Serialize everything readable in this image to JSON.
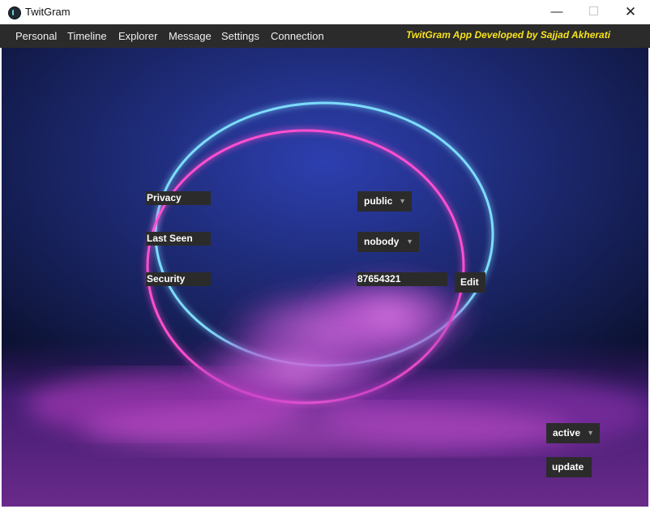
{
  "window": {
    "title": "TwitGram",
    "controls": {
      "minimize": "—",
      "maximize": "",
      "close": "✕"
    }
  },
  "menu": {
    "items": [
      {
        "label": "Personal"
      },
      {
        "label": "Timeline"
      },
      {
        "label": "Explorer"
      },
      {
        "label": "Message"
      },
      {
        "label": "Settings"
      },
      {
        "label": "Connection"
      }
    ],
    "credit": "TwitGram App Developed by Sajjad Akherati",
    "credit_color": "#f7e21c"
  },
  "settings": {
    "privacy_label": "Privacy",
    "privacy_value": "public",
    "last_seen_label": "Last Seen",
    "last_seen_value": "nobody",
    "security_label": "Security",
    "security_value": "87654321",
    "edit_button": "Edit",
    "status_value": "active",
    "update_button": "update"
  },
  "icons": {
    "dropdown_arrow": "chevron-down-icon",
    "app": "twitgram-app-icon"
  },
  "colors": {
    "panel": "#2b2b2b",
    "menubar": "#2b2b2b",
    "text": "#ffffff",
    "ring_pink": "#ff4fd0",
    "ring_blue": "#6fd8ff"
  }
}
